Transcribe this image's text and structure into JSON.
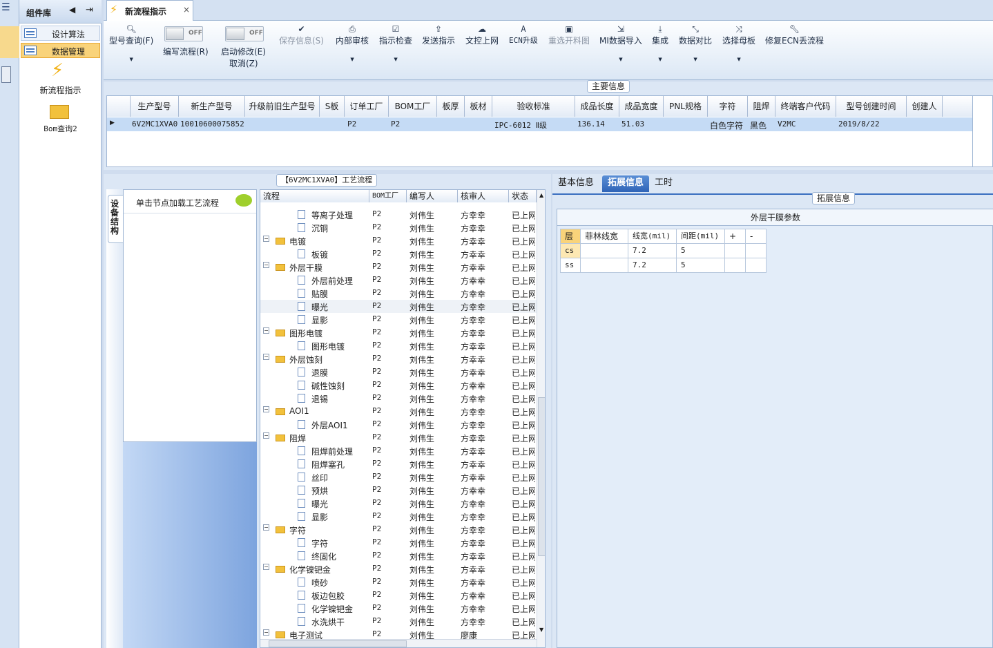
{
  "sidebar": {
    "title": "组件库",
    "items": [
      {
        "label": "设计算法"
      },
      {
        "label": "数据管理"
      }
    ],
    "modules": [
      {
        "label": "新流程指示"
      },
      {
        "label": "Bom查询2"
      }
    ]
  },
  "tab": {
    "title": "新流程指示",
    "close": "×"
  },
  "toolbar": {
    "query": "型号查询(F)",
    "edit_flow": "编写流程(R)",
    "edit_toggle": "OFF",
    "start_modify": "启动修改(E)",
    "cancel": "取消(Z)",
    "start_toggle": "OFF",
    "save": "保存信息(S)",
    "internal_review": "内部审核",
    "check": "指示检查",
    "send": "发送指示",
    "upload": "文控上网",
    "ecn": "ECN升级",
    "reselect": "重选开料图",
    "mi_import": "MI数据导入",
    "integrate": "集成",
    "compare": "数据对比",
    "select_mother": "选择母板",
    "fix_ecn": "修复ECN丢流程"
  },
  "main_info": {
    "caption": "主要信息",
    "headers": [
      "生产型号",
      "新生产型号",
      "升级前旧生产型号",
      "S板",
      "订单工厂",
      "BOM工厂",
      "板厚",
      "板材",
      "验收标准",
      "成品长度",
      "成品宽度",
      "PNL规格",
      "字符",
      "阻焊",
      "终端客户代码",
      "型号创建时间",
      "创建人"
    ],
    "row": [
      "6V2MC1XVA0",
      "10010600075852",
      "",
      "",
      "P2",
      "P2",
      "",
      "",
      "IPC-6012 Ⅱ级",
      "136.14",
      "51.03",
      "",
      "白色字符",
      "黑色",
      "V2MC",
      "2019/8/22",
      ""
    ]
  },
  "process": {
    "caption": "【6V2MC1XVA0】工艺流程",
    "device_tab": "设备结构",
    "node_hint": "单击节点加载工艺流程",
    "headers": [
      "流程",
      "BOM工厂",
      "编写人",
      "核审人",
      "状态"
    ],
    "rows": [
      {
        "name": "等离子处理",
        "level": 2,
        "type": "doc",
        "bom": "P2",
        "writer": "刘伟生",
        "reviewer": "方幸幸",
        "status": "已上网"
      },
      {
        "name": "沉铜",
        "level": 2,
        "type": "doc",
        "bom": "P2",
        "writer": "刘伟生",
        "reviewer": "方幸幸",
        "status": "已上网"
      },
      {
        "name": "电镀",
        "level": 1,
        "type": "folder",
        "bom": "P2",
        "writer": "刘伟生",
        "reviewer": "方幸幸",
        "status": "已上网"
      },
      {
        "name": "板镀",
        "level": 2,
        "type": "doc",
        "bom": "P2",
        "writer": "刘伟生",
        "reviewer": "方幸幸",
        "status": "已上网"
      },
      {
        "name": "外层干膜",
        "level": 1,
        "type": "folder",
        "bom": "P2",
        "writer": "刘伟生",
        "reviewer": "方幸幸",
        "status": "已上网"
      },
      {
        "name": "外层前处理",
        "level": 2,
        "type": "doc",
        "bom": "P2",
        "writer": "刘伟生",
        "reviewer": "方幸幸",
        "status": "已上网"
      },
      {
        "name": "贴膜",
        "level": 2,
        "type": "doc",
        "bom": "P2",
        "writer": "刘伟生",
        "reviewer": "方幸幸",
        "status": "已上网"
      },
      {
        "name": "曝光",
        "level": 2,
        "type": "doc",
        "bom": "P2",
        "writer": "刘伟生",
        "reviewer": "方幸幸",
        "status": "已上网"
      },
      {
        "name": "显影",
        "level": 2,
        "type": "doc",
        "bom": "P2",
        "writer": "刘伟生",
        "reviewer": "方幸幸",
        "status": "已上网"
      },
      {
        "name": "图形电镀",
        "level": 1,
        "type": "folder",
        "bom": "P2",
        "writer": "刘伟生",
        "reviewer": "方幸幸",
        "status": "已上网"
      },
      {
        "name": "图形电镀",
        "level": 2,
        "type": "doc",
        "bom": "P2",
        "writer": "刘伟生",
        "reviewer": "方幸幸",
        "status": "已上网"
      },
      {
        "name": "外层蚀刻",
        "level": 1,
        "type": "folder",
        "bom": "P2",
        "writer": "刘伟生",
        "reviewer": "方幸幸",
        "status": "已上网"
      },
      {
        "name": "退膜",
        "level": 2,
        "type": "doc",
        "bom": "P2",
        "writer": "刘伟生",
        "reviewer": "方幸幸",
        "status": "已上网"
      },
      {
        "name": "碱性蚀刻",
        "level": 2,
        "type": "doc",
        "bom": "P2",
        "writer": "刘伟生",
        "reviewer": "方幸幸",
        "status": "已上网"
      },
      {
        "name": "退锡",
        "level": 2,
        "type": "doc",
        "bom": "P2",
        "writer": "刘伟生",
        "reviewer": "方幸幸",
        "status": "已上网"
      },
      {
        "name": "AOI1",
        "level": 1,
        "type": "folder",
        "bom": "P2",
        "writer": "刘伟生",
        "reviewer": "方幸幸",
        "status": "已上网"
      },
      {
        "name": "外层AOI1",
        "level": 2,
        "type": "doc",
        "bom": "P2",
        "writer": "刘伟生",
        "reviewer": "方幸幸",
        "status": "已上网"
      },
      {
        "name": "阻焊",
        "level": 1,
        "type": "folder",
        "bom": "P2",
        "writer": "刘伟生",
        "reviewer": "方幸幸",
        "status": "已上网"
      },
      {
        "name": "阻焊前处理",
        "level": 2,
        "type": "doc",
        "bom": "P2",
        "writer": "刘伟生",
        "reviewer": "方幸幸",
        "status": "已上网"
      },
      {
        "name": "阻焊塞孔",
        "level": 2,
        "type": "doc",
        "bom": "P2",
        "writer": "刘伟生",
        "reviewer": "方幸幸",
        "status": "已上网"
      },
      {
        "name": "丝印",
        "level": 2,
        "type": "doc",
        "bom": "P2",
        "writer": "刘伟生",
        "reviewer": "方幸幸",
        "status": "已上网"
      },
      {
        "name": "预烘",
        "level": 2,
        "type": "doc",
        "bom": "P2",
        "writer": "刘伟生",
        "reviewer": "方幸幸",
        "status": "已上网"
      },
      {
        "name": "曝光",
        "level": 2,
        "type": "doc",
        "bom": "P2",
        "writer": "刘伟生",
        "reviewer": "方幸幸",
        "status": "已上网"
      },
      {
        "name": "显影",
        "level": 2,
        "type": "doc",
        "bom": "P2",
        "writer": "刘伟生",
        "reviewer": "方幸幸",
        "status": "已上网"
      },
      {
        "name": "字符",
        "level": 1,
        "type": "folder",
        "bom": "P2",
        "writer": "刘伟生",
        "reviewer": "方幸幸",
        "status": "已上网"
      },
      {
        "name": "字符",
        "level": 2,
        "type": "doc",
        "bom": "P2",
        "writer": "刘伟生",
        "reviewer": "方幸幸",
        "status": "已上网"
      },
      {
        "name": "终固化",
        "level": 2,
        "type": "doc",
        "bom": "P2",
        "writer": "刘伟生",
        "reviewer": "方幸幸",
        "status": "已上网"
      },
      {
        "name": "化学镍钯金",
        "level": 1,
        "type": "folder",
        "bom": "P2",
        "writer": "刘伟生",
        "reviewer": "方幸幸",
        "status": "已上网"
      },
      {
        "name": "喷砂",
        "level": 2,
        "type": "doc",
        "bom": "P2",
        "writer": "刘伟生",
        "reviewer": "方幸幸",
        "status": "已上网"
      },
      {
        "name": "板边包胶",
        "level": 2,
        "type": "doc",
        "bom": "P2",
        "writer": "刘伟生",
        "reviewer": "方幸幸",
        "status": "已上网"
      },
      {
        "name": "化学镍钯金",
        "level": 2,
        "type": "doc",
        "bom": "P2",
        "writer": "刘伟生",
        "reviewer": "方幸幸",
        "status": "已上网"
      },
      {
        "name": "水洗烘干",
        "level": 2,
        "type": "doc",
        "bom": "P2",
        "writer": "刘伟生",
        "reviewer": "方幸幸",
        "status": "已上网"
      },
      {
        "name": "电子测试",
        "level": 1,
        "type": "folder",
        "bom": "P2",
        "writer": "刘伟生",
        "reviewer": "廖康",
        "status": "已上网"
      }
    ]
  },
  "details": {
    "tabs": [
      "基本信息",
      "拓展信息",
      "工时"
    ],
    "caption": "拓展信息",
    "table_title": "外层干膜参数",
    "headers": [
      "层",
      "菲林线宽",
      "线宽(mil)",
      "间距(mil)",
      "+",
      "-"
    ],
    "rows": [
      [
        "cs",
        "",
        "7.2",
        "5",
        "",
        ""
      ],
      [
        "ss",
        "",
        "7.2",
        "5",
        "",
        ""
      ]
    ]
  }
}
